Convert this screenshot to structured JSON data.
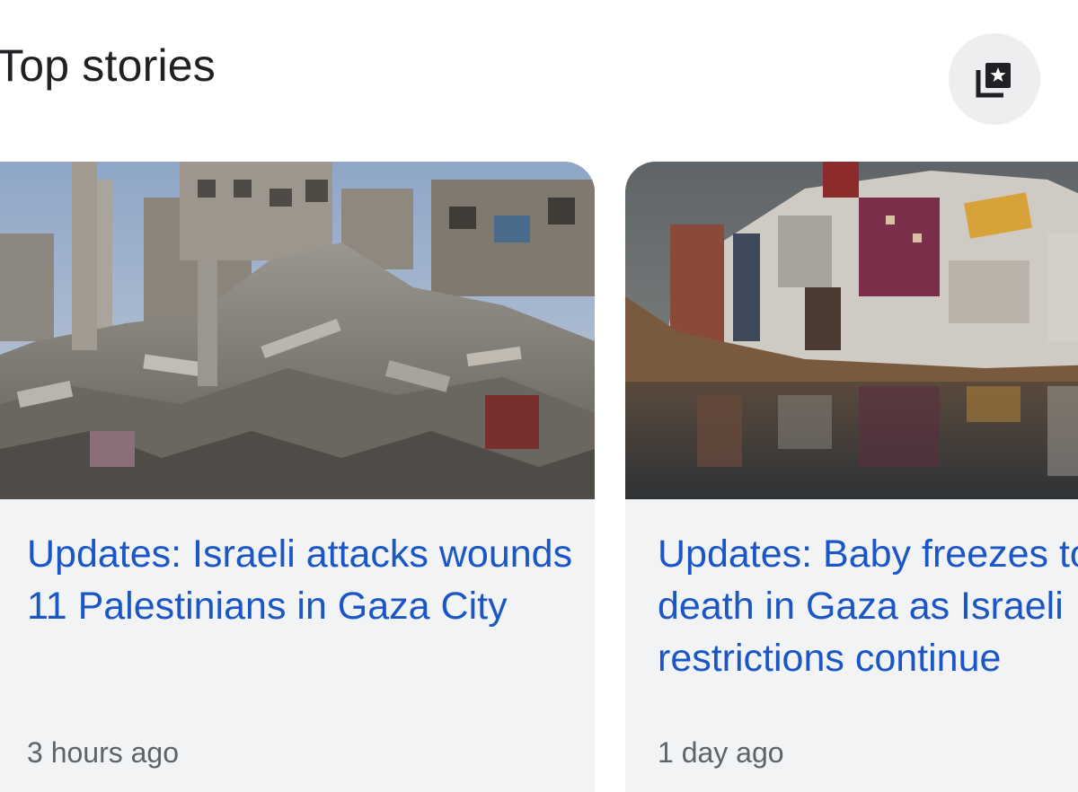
{
  "header": {
    "title": "Top stories",
    "bookmark_icon": "bookmark-collection-icon"
  },
  "stories": [
    {
      "headline_lines": [
        "Updates: Israeli attacks wounds 11 Palestinians in Gaza City"
      ],
      "time": "3 hours ago",
      "image": "rubble-destroyed-buildings-photo"
    },
    {
      "headline_lines": [
        "Updates: Baby freezes to",
        "death in Gaza as Israeli",
        "restrictions continue"
      ],
      "time": "1 day ago",
      "image": "tent-camp-flooded-puddle-photo"
    }
  ],
  "colors": {
    "headline": "#1a56c6",
    "timestamp": "#5f6368",
    "card_bg": "#f1f3f4",
    "button_bg": "#eeeef0"
  }
}
